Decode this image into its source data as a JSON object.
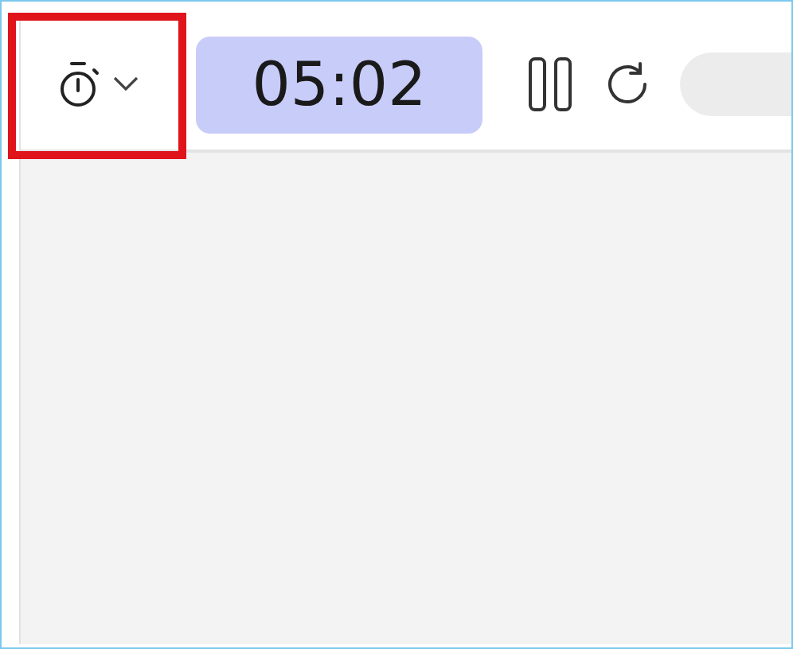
{
  "toolbar": {
    "timer_menu": {
      "highlighted": true
    },
    "time_display": "05:02",
    "paused": false
  }
}
